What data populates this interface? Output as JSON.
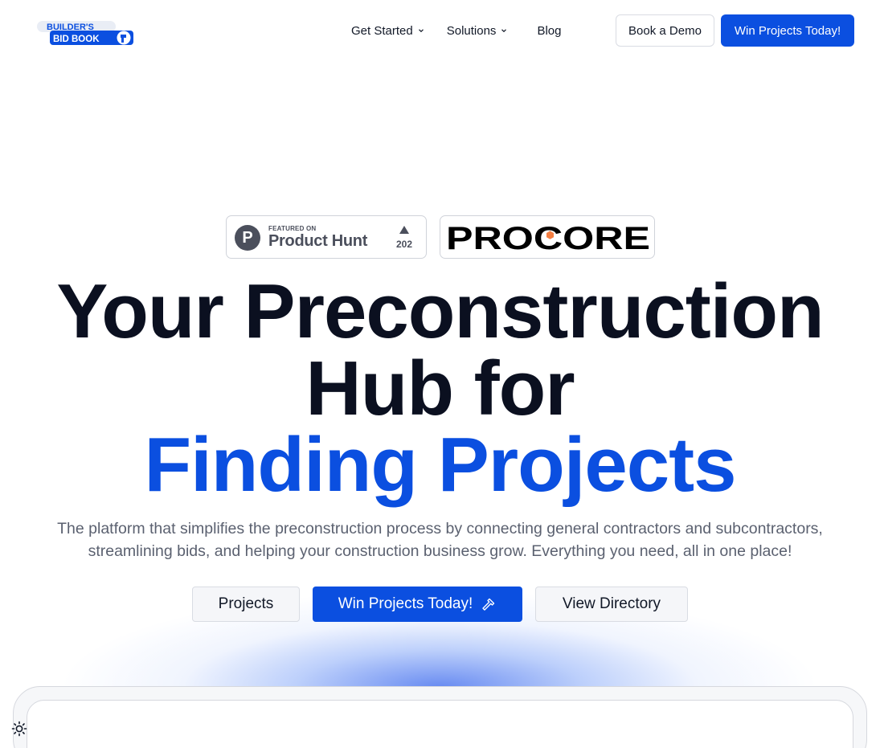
{
  "header": {
    "logo": {
      "line1": "BUILDER'S",
      "line2": "BID BOOK",
      "icon": "hammer-arrow-icon"
    },
    "nav": [
      {
        "label": "Get Started",
        "has_dropdown": true
      },
      {
        "label": "Solutions",
        "has_dropdown": true
      },
      {
        "label": "Blog",
        "has_dropdown": false
      }
    ],
    "book_demo_label": "Book a Demo",
    "win_projects_label": "Win Projects Today!"
  },
  "badges": {
    "product_hunt": {
      "featured_label": "FEATURED ON",
      "name": "Product Hunt",
      "upvotes": "202",
      "icon": "product-hunt-p-icon"
    },
    "procore": {
      "name": "PROCORE"
    }
  },
  "hero": {
    "line1": "Your Preconstruction",
    "line2": "Hub for",
    "line3": "Finding Projects",
    "subtext_line1": "The platform that simplifies the preconstruction process by connecting general contractors and subcontractors,",
    "subtext_line2": "streamlining bids, and helping your construction business grow. Everything you need, all in one place!"
  },
  "cta": {
    "projects_label": "Projects",
    "win_label": "Win Projects Today!",
    "win_icon": "hammer-icon",
    "directory_label": "View Directory"
  },
  "theme_toggle": {
    "icon": "sun-icon"
  },
  "colors": {
    "brand_blue": "#0b4fe0",
    "heading_dark": "#0b1020",
    "body_gray": "#5b6170",
    "procore_orange": "#f47e42"
  }
}
